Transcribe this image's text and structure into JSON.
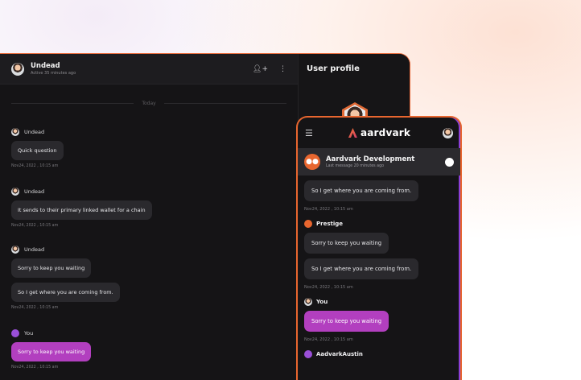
{
  "desktop": {
    "header": {
      "name": "Undead",
      "status": "Active 35 minutes ago",
      "add_user_icon": "add-user-icon",
      "more_icon": "more-vertical-icon"
    },
    "divider": "Today",
    "messages": [
      {
        "sender": "Undead",
        "bubbles": [
          "Quick question"
        ],
        "time": "Nov24, 2022 , 10:15 am"
      },
      {
        "sender": "Undead",
        "bubbles": [
          "It sends to their primary linked wallet for a chain"
        ],
        "time": "Nov24, 2022 , 10:15 am"
      },
      {
        "sender": "Undead",
        "bubbles": [
          "Sorry to keep you waiting",
          "So I get where you are coming from."
        ],
        "time": "Nov24, 2022 , 10:15 am"
      },
      {
        "sender": "You",
        "bubbles": [
          "Sorry to keep you waiting"
        ],
        "time": "Nov24, 2022 , 10:15 am"
      }
    ],
    "profile": {
      "title": "User profile"
    }
  },
  "phone": {
    "brand": "aardvark",
    "menu_icon": "hamburger-menu-icon",
    "group": {
      "name": "Aardvark Development",
      "sub": "Last message 20 minutes ago"
    },
    "items": {
      "b1": "So I get where you are coming from.",
      "t1": "Nov24, 2022 , 10:15 am",
      "s2": "Prestige",
      "b2": "Sorry to keep you waiting",
      "b3": "So I get where you are coming from.",
      "t2": "Nov24, 2022 , 10:15 am",
      "s3": "You",
      "b4": "Sorry to keep you waiting",
      "t3": "Nov24, 2022 , 10:15 am",
      "s4": "AadvarkAustin"
    }
  },
  "colors": {
    "accent": "#e8662f",
    "my_bubble": "#b23fbf",
    "bg_dark": "#151416"
  }
}
